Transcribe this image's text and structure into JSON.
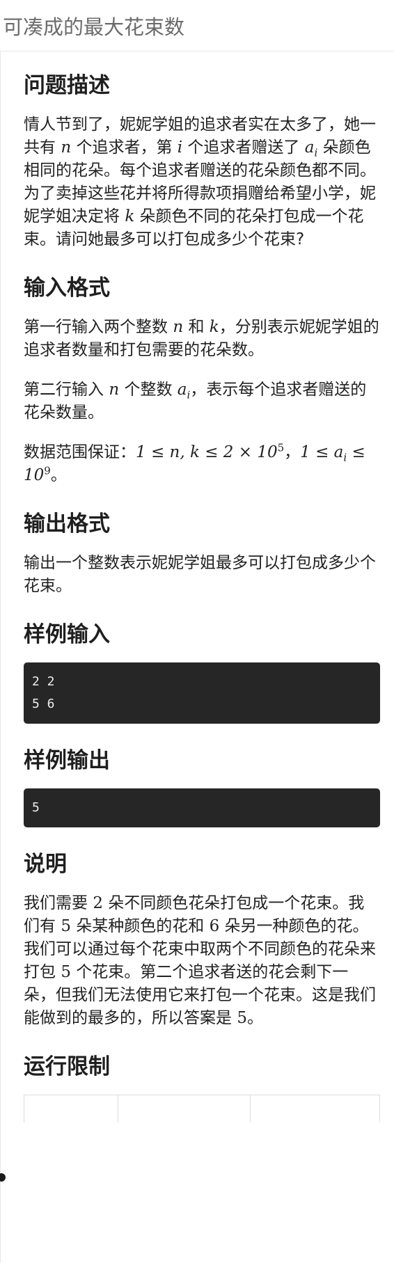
{
  "page": {
    "title": "可凑成的最大花束数"
  },
  "sections": {
    "description": {
      "heading": "问题描述",
      "t1": "情人节到了，妮妮学姐的追求者实在太多了，她一共有 ",
      "v_n": "n",
      "t2": " 个追求者，第 ",
      "v_i": "i",
      "t3": " 个追求者赠送了 ",
      "v_a": "a",
      "v_a_sub": "i",
      "t4": " 朵颜色相同的花朵。每个追求者赠送的花朵颜色都不同。为了卖掉这些花并将所得款项捐赠给希望小学，妮妮学姐决定将 ",
      "v_k": "k",
      "t5": " 朵颜色不同的花朵打包成一个花束。请问她最多可以打包成多少个花束?"
    },
    "input": {
      "heading": "输入格式",
      "p1_t1": "第一行输入两个整数 ",
      "p1_n": "n",
      "p1_t2": " 和 ",
      "p1_k": "k",
      "p1_t3": "，分别表示妮妮学姐的追求者数量和打包需要的花朵数。",
      "p2_t1": "第二行输入 ",
      "p2_n": "n",
      "p2_t2": " 个整数 ",
      "p2_a": "a",
      "p2_a_sub": "i",
      "p2_t3": "，表示每个追求者赠送的花朵数量。",
      "p3_t1": "数据范围保证：",
      "p3_m1": "1 ≤ n, k ≤ 2 × 10",
      "p3_m1_sup": "5",
      "p3_t2": "，",
      "p3_m2": "1 ≤ ",
      "p3_m2_a": "a",
      "p3_m2_sub": "i",
      "p3_m2_rest": " ≤ 10",
      "p3_m2_sup": "9",
      "p3_t3": "。"
    },
    "output": {
      "heading": "输出格式",
      "text": "输出一个整数表示妮妮学姐最多可以打包成多少个花束。"
    },
    "sample_input": {
      "heading": "样例输入",
      "line1": "2 2",
      "line2": "5 6"
    },
    "sample_output": {
      "heading": "样例输出",
      "line1": "5"
    },
    "explanation": {
      "heading": "说明",
      "t1": "我们需要 ",
      "v1": "2",
      "t2": " 朵不同颜色花朵打包成一个花束。我们有 ",
      "v2": "5",
      "t3": " 朵某种颜色的花和 ",
      "v3": "6",
      "t4": " 朵另一种颜色的花。我们可以通过每个花束中取两个不同颜色的花朵来打包 ",
      "v4": "5",
      "t5": " 个花束。第二个追求者送的花会剩下一朵，但我们无法使用它来打包一个花束。这是我们能做到的最多的，所以答案是 ",
      "v5": "5",
      "t6": "。"
    },
    "limits": {
      "heading": "运行限制"
    }
  },
  "colors": {
    "code_background": "#262626",
    "code_text": "#ececec",
    "title_text": "#6b6b6b"
  }
}
